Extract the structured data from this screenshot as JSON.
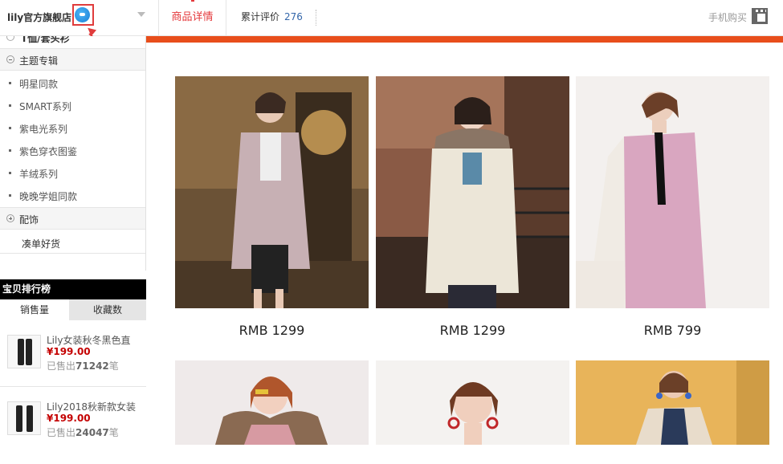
{
  "header": {
    "shop_name": "lily官方旗舰店",
    "tabs": {
      "detail": "商品详情",
      "reviews_label": "累计评价",
      "reviews_count": "276"
    },
    "mobile_buy": "手机购买"
  },
  "sidebar": {
    "partial_top_item": "T恤/套头衫",
    "categories": [
      {
        "label": "主题专辑",
        "expanded": true,
        "items": [
          "明星同款",
          "SMART系列",
          "紫电光系列",
          "紫色穿衣图鉴",
          "羊绒系列",
          "晚晚学姐同款"
        ]
      },
      {
        "label": "配饰",
        "expanded": false,
        "items": []
      }
    ],
    "extra_item": "凑单好货"
  },
  "ranking": {
    "title": "宝贝排行榜",
    "tabs": [
      "销售量",
      "收藏数"
    ],
    "items": [
      {
        "name": "Lily女装秋冬黑色直",
        "price": "¥199.00",
        "sold_prefix": "已售出",
        "sold_count": "71242",
        "sold_suffix": "笔"
      },
      {
        "name": "Lily2018秋新款女装",
        "price": "¥199.00",
        "sold_prefix": "已售出",
        "sold_count": "24047",
        "sold_suffix": "笔"
      }
    ]
  },
  "products": [
    {
      "price": "RMB 1299"
    },
    {
      "price": "RMB 1299"
    },
    {
      "price": "RMB 799"
    },
    {
      "price": ""
    },
    {
      "price": ""
    },
    {
      "price": ""
    }
  ],
  "colors": {
    "accent_red": "#e84e1b",
    "tab_active": "#e4393c",
    "price_red": "#c40000",
    "annotation": "#e03c3c"
  },
  "icons": [
    "wangwang-icon",
    "dropdown-chevron-icon",
    "qr-code-icon",
    "expand-toggle-icon",
    "collapse-toggle-icon"
  ]
}
